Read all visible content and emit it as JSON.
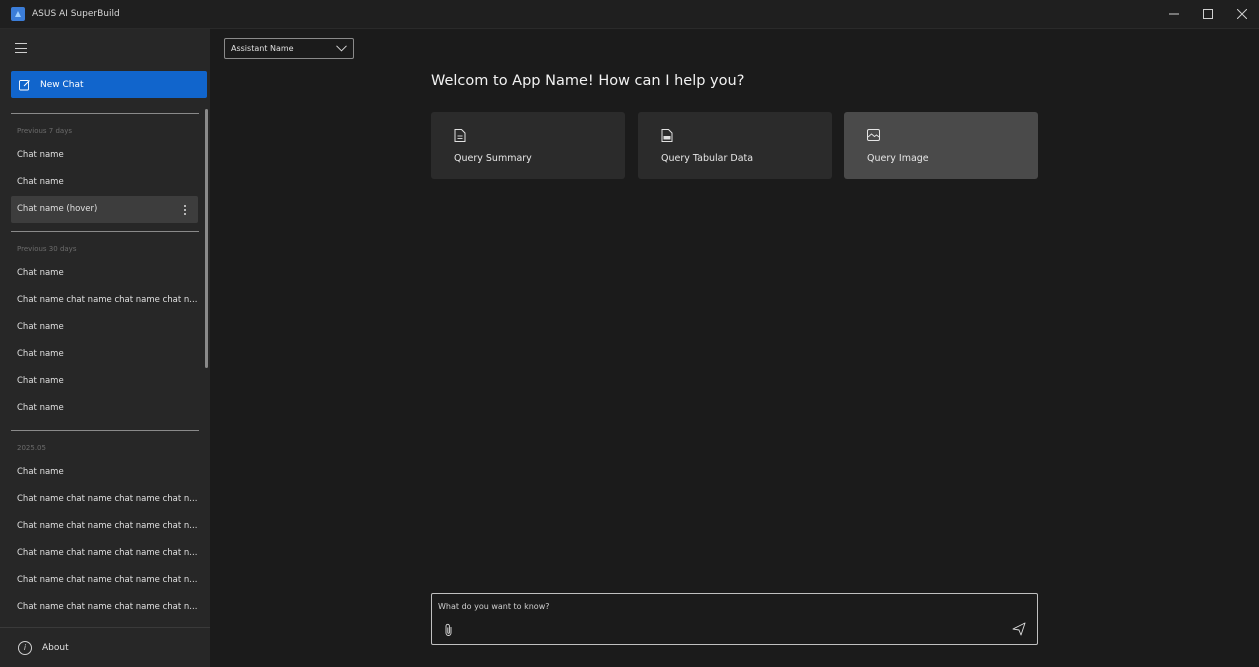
{
  "window": {
    "title": "ASUS AI SuperBuild",
    "controls": {
      "minimize": "—",
      "maximize": "☐",
      "close": "✕"
    }
  },
  "sidebar": {
    "menu_icon": "hamburger-icon",
    "new_chat_label": "New Chat",
    "groups": [
      {
        "label": "Previous 7 days",
        "items": [
          {
            "label": "Chat name"
          },
          {
            "label": "Chat name"
          },
          {
            "label": "Chat name (hover)",
            "hover": true
          }
        ]
      },
      {
        "label": "Previous 30 days",
        "items": [
          {
            "label": "Chat name"
          },
          {
            "label": "Chat name chat name chat name chat n..."
          },
          {
            "label": "Chat name"
          },
          {
            "label": "Chat name"
          },
          {
            "label": "Chat name"
          },
          {
            "label": "Chat name"
          }
        ]
      },
      {
        "label": "2025.05",
        "items": [
          {
            "label": "Chat name"
          },
          {
            "label": "Chat name chat name chat name chat n..."
          },
          {
            "label": "Chat name chat name chat name chat n..."
          },
          {
            "label": "Chat name chat name chat name chat n..."
          },
          {
            "label": "Chat name chat name chat name chat n..."
          },
          {
            "label": "Chat name chat name chat name chat n..."
          }
        ]
      }
    ],
    "about_label": "About"
  },
  "main": {
    "assistant_select": "Assistant Name",
    "welcome": "Welcom to App Name! How can I help you?",
    "cards": [
      {
        "label": "Query Summary",
        "icon": "document-icon"
      },
      {
        "label": "Query Tabular Data",
        "icon": "csv-file-icon"
      },
      {
        "label": "Query Image",
        "icon": "image-icon",
        "hover": true
      }
    ],
    "input": {
      "placeholder": "What do you want to know?",
      "value": ""
    }
  },
  "colors": {
    "accent": "#1165cc",
    "background": "#1b1b1b",
    "sidebar": "#272727",
    "card": "#2b2b2b",
    "card_hover": "#4a4a4a"
  }
}
